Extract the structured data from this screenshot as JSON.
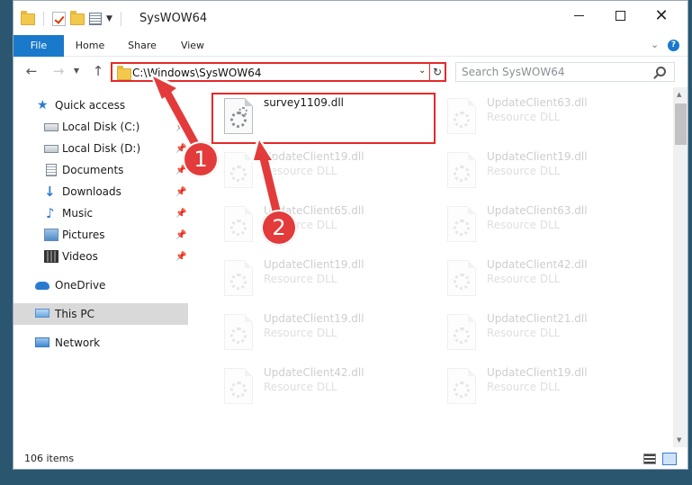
{
  "window": {
    "title": "SysWOW64"
  },
  "ribbon": {
    "tabs": [
      "File",
      "Home",
      "Share",
      "View"
    ],
    "help": "?"
  },
  "nav": {
    "back": "←",
    "forward": "→",
    "up": "↑",
    "address": "C:\\Windows\\SysWOW64",
    "search_placeholder": "Search SysWOW64"
  },
  "sidebar": {
    "items": [
      {
        "label": "Quick access",
        "icon": "star-icon",
        "pinned": false
      },
      {
        "label": "Local Disk (C:)",
        "icon": "drive-icon",
        "pinned": true
      },
      {
        "label": "Local Disk (D:)",
        "icon": "drive-icon",
        "pinned": true
      },
      {
        "label": "Documents",
        "icon": "documents-icon",
        "pinned": true
      },
      {
        "label": "Downloads",
        "icon": "downloads-icon",
        "pinned": true
      },
      {
        "label": "Music",
        "icon": "music-icon",
        "pinned": true
      },
      {
        "label": "Pictures",
        "icon": "pictures-icon",
        "pinned": true
      },
      {
        "label": "Videos",
        "icon": "videos-icon",
        "pinned": true
      },
      {
        "label": "OneDrive",
        "icon": "onedrive-icon",
        "pinned": false
      },
      {
        "label": "This PC",
        "icon": "this-pc-icon",
        "pinned": false,
        "selected": true
      },
      {
        "label": "Network",
        "icon": "network-icon",
        "pinned": false
      }
    ]
  },
  "files": {
    "highlighted": {
      "name": "survey1109.dll"
    },
    "col1": [
      {
        "name": "UpdateClient19.dll",
        "desc": "Resource DLL"
      },
      {
        "name": "UpdateClient65.dll",
        "desc": "Resource DLL"
      },
      {
        "name": "UpdateClient19.dll",
        "desc": "Resource DLL"
      },
      {
        "name": "UpdateClient19.dll",
        "desc": "Resource DLL"
      },
      {
        "name": "UpdateClient42.dll",
        "desc": "Resource DLL"
      }
    ],
    "col2": [
      {
        "name": "UpdateClient63.dll",
        "desc": "Resource DLL"
      },
      {
        "name": "UpdateClient19.dll",
        "desc": "Resource DLL"
      },
      {
        "name": "UpdateClient63.dll",
        "desc": "Resource DLL"
      },
      {
        "name": "UpdateClient42.dll",
        "desc": "Resource DLL"
      },
      {
        "name": "UpdateClient21.dll",
        "desc": "Resource DLL"
      },
      {
        "name": "UpdateClient19.dll",
        "desc": "Resource DLL"
      }
    ]
  },
  "status": {
    "item_count": "106 items"
  },
  "annotations": {
    "step1": "1",
    "step2": "2",
    "color": "#e33b3b"
  }
}
